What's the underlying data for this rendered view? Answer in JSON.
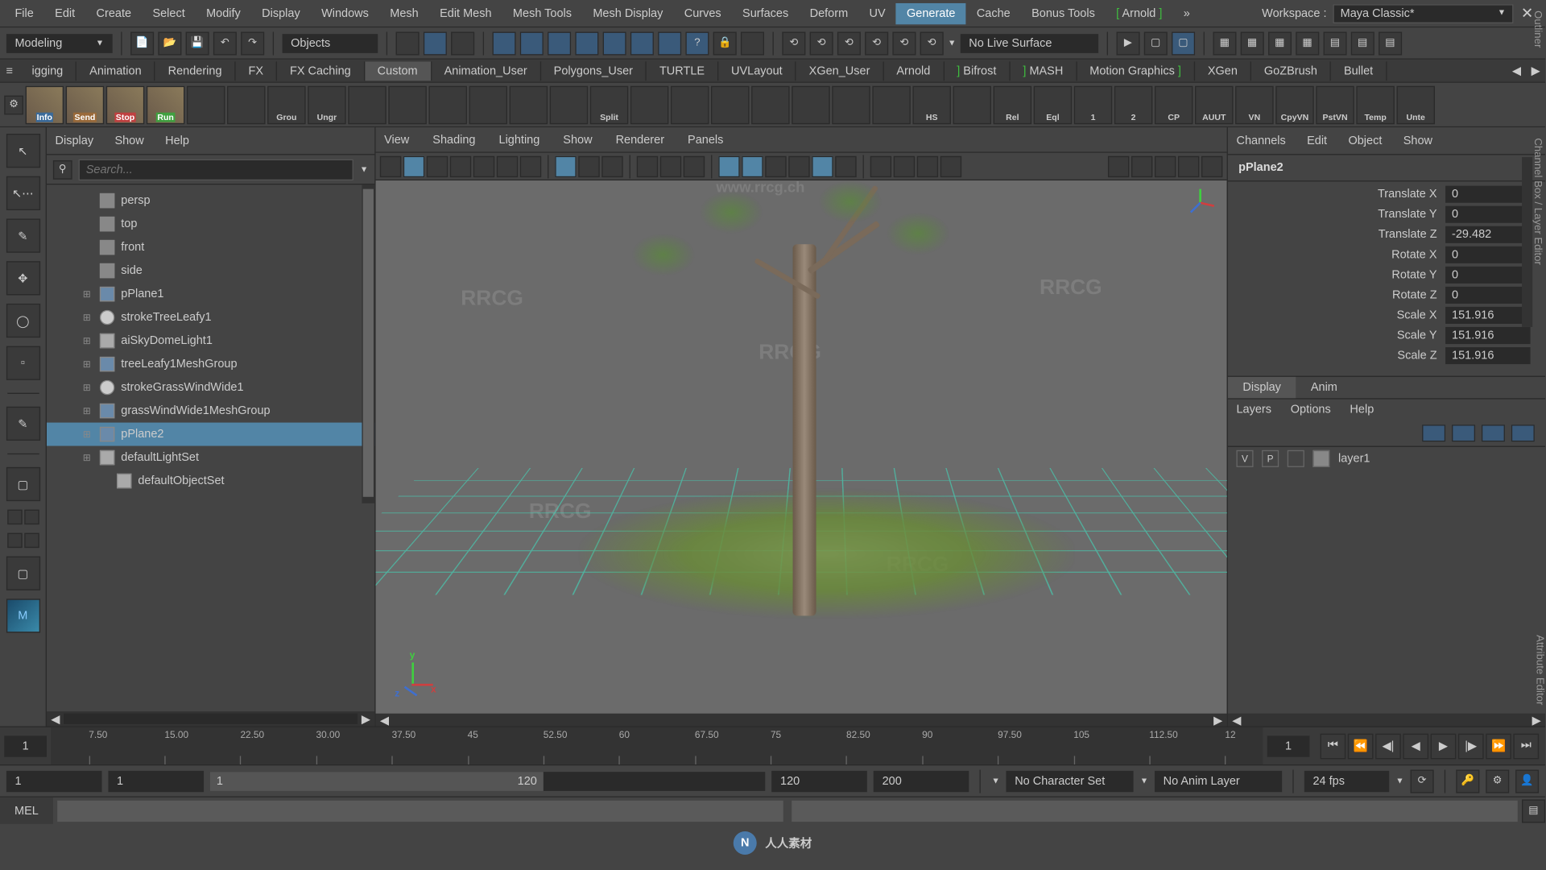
{
  "menubar": {
    "items": [
      "File",
      "Edit",
      "Create",
      "Select",
      "Modify",
      "Display",
      "Windows",
      "Mesh",
      "Edit Mesh",
      "Mesh Tools",
      "Mesh Display",
      "Curves",
      "Surfaces",
      "Deform",
      "UV",
      "Generate",
      "Cache",
      "Bonus Tools",
      "Arnold"
    ],
    "highlighted_index": 15,
    "bracket_indices": [
      18
    ],
    "workspace_label": "Workspace :",
    "workspace_value": "Maya Classic*"
  },
  "toolbar1": {
    "mode": "Modeling",
    "search_label": "Objects",
    "live_surface": "No Live Surface"
  },
  "shelftabs": {
    "tabs": [
      "igging",
      "Animation",
      "Rendering",
      "FX",
      "FX Caching",
      "Custom",
      "Animation_User",
      "Polygons_User",
      "TURTLE",
      "UVLayout",
      "XGen_User",
      "Arnold",
      "Bifrost",
      "MASH",
      "Motion Graphics",
      "XGen",
      "GoZBrush",
      "Bullet"
    ],
    "active_index": 5,
    "green_indices": [
      12,
      13
    ]
  },
  "shelf": {
    "buttons": [
      {
        "lbl": "Info",
        "cls": "img info"
      },
      {
        "lbl": "Send",
        "cls": "img send"
      },
      {
        "lbl": "Stop",
        "cls": "img stop"
      },
      {
        "lbl": "Run",
        "cls": "img run"
      },
      {
        "lbl": "",
        "cls": ""
      },
      {
        "lbl": "",
        "cls": ""
      },
      {
        "lbl": "Grou",
        "cls": ""
      },
      {
        "lbl": "Ungr",
        "cls": ""
      },
      {
        "lbl": "",
        "cls": ""
      },
      {
        "lbl": "",
        "cls": ""
      },
      {
        "lbl": "",
        "cls": ""
      },
      {
        "lbl": "",
        "cls": ""
      },
      {
        "lbl": "",
        "cls": ""
      },
      {
        "lbl": "",
        "cls": ""
      },
      {
        "lbl": "Split",
        "cls": ""
      },
      {
        "lbl": "",
        "cls": ""
      },
      {
        "lbl": "",
        "cls": ""
      },
      {
        "lbl": "",
        "cls": ""
      },
      {
        "lbl": "",
        "cls": ""
      },
      {
        "lbl": "",
        "cls": ""
      },
      {
        "lbl": "",
        "cls": ""
      },
      {
        "lbl": "",
        "cls": ""
      },
      {
        "lbl": "HS",
        "cls": ""
      },
      {
        "lbl": "",
        "cls": ""
      },
      {
        "lbl": "Rel",
        "cls": ""
      },
      {
        "lbl": "Eql",
        "cls": ""
      },
      {
        "lbl": "1",
        "cls": ""
      },
      {
        "lbl": "2",
        "cls": ""
      },
      {
        "lbl": "CP",
        "cls": ""
      },
      {
        "lbl": "AUUT",
        "cls": ""
      },
      {
        "lbl": "VN",
        "cls": ""
      },
      {
        "lbl": "CpyVN",
        "cls": ""
      },
      {
        "lbl": "PstVN",
        "cls": ""
      },
      {
        "lbl": "Temp",
        "cls": ""
      },
      {
        "lbl": "Unte",
        "cls": ""
      }
    ]
  },
  "outliner": {
    "menu": [
      "Display",
      "Show",
      "Help"
    ],
    "vtitle": "Outliner",
    "search_placeholder": "Search...",
    "items": [
      {
        "name": "persp",
        "icon": "cam",
        "dim": true,
        "indent": 1
      },
      {
        "name": "top",
        "icon": "cam",
        "dim": true,
        "indent": 1
      },
      {
        "name": "front",
        "icon": "cam",
        "dim": true,
        "indent": 1
      },
      {
        "name": "side",
        "icon": "cam",
        "dim": true,
        "indent": 1
      },
      {
        "name": "pPlane1",
        "icon": "mesh",
        "indent": 1,
        "expand": "⊞"
      },
      {
        "name": "strokeTreeLeafy1",
        "icon": "stroke",
        "indent": 1,
        "expand": "⊞"
      },
      {
        "name": "aiSkyDomeLight1",
        "icon": "light",
        "indent": 1,
        "expand": "⊞"
      },
      {
        "name": "treeLeafy1MeshGroup",
        "icon": "mesh",
        "indent": 1,
        "expand": "⊞"
      },
      {
        "name": "strokeGrassWindWide1",
        "icon": "stroke",
        "indent": 1,
        "expand": "⊞"
      },
      {
        "name": "grassWindWide1MeshGroup",
        "icon": "mesh",
        "indent": 1,
        "expand": "⊞"
      },
      {
        "name": "pPlane2",
        "icon": "mesh",
        "indent": 1,
        "expand": "⊞",
        "selected": true
      },
      {
        "name": "defaultLightSet",
        "icon": "light",
        "indent": 1,
        "expand": "⊞"
      },
      {
        "name": "defaultObjectSet",
        "icon": "light",
        "indent": 2
      }
    ]
  },
  "viewport": {
    "menu": [
      "View",
      "Shading",
      "Lighting",
      "Show",
      "Renderer",
      "Panels"
    ],
    "axis": {
      "x": "x",
      "y": "y",
      "z": "z"
    },
    "watermark_url": "www.rrcg.ch",
    "watermark_text": "RRCG"
  },
  "channelbox": {
    "menu": [
      "Channels",
      "Edit",
      "Object",
      "Show"
    ],
    "vtitle": "Channel Box / Layer Editor",
    "object": "pPlane2",
    "attrs": [
      {
        "name": "Translate X",
        "val": "0"
      },
      {
        "name": "Translate Y",
        "val": "0"
      },
      {
        "name": "Translate Z",
        "val": "-29.482"
      },
      {
        "name": "Rotate X",
        "val": "0"
      },
      {
        "name": "Rotate Y",
        "val": "0"
      },
      {
        "name": "Rotate Z",
        "val": "0"
      },
      {
        "name": "Scale X",
        "val": "151.916"
      },
      {
        "name": "Scale Y",
        "val": "151.916"
      },
      {
        "name": "Scale Z",
        "val": "151.916"
      }
    ],
    "layer_tabs": [
      "Display",
      "Anim"
    ],
    "layer_menu": [
      "Layers",
      "Options",
      "Help"
    ],
    "layer": {
      "v": "V",
      "p": "P",
      "name": "layer1"
    }
  },
  "timeline": {
    "ticks": [
      "7.50",
      "15.00",
      "22.50",
      "30.00",
      "37.50",
      "45",
      "52.50",
      "60",
      "67.50",
      "75",
      "82.50",
      "90",
      "97.50",
      "105",
      "112.50",
      "12"
    ],
    "current_start": "1",
    "current_end": "1"
  },
  "range": {
    "start": "1",
    "range_start": "1",
    "range_shown_start": "1",
    "range_shown_end": "120",
    "range_end": "120",
    "end": "200",
    "character": "No Character Set",
    "anim_layer": "No Anim Layer",
    "fps": "24 fps"
  },
  "cmdline": {
    "mode": "MEL"
  },
  "footer": {
    "text": "人人素材"
  }
}
